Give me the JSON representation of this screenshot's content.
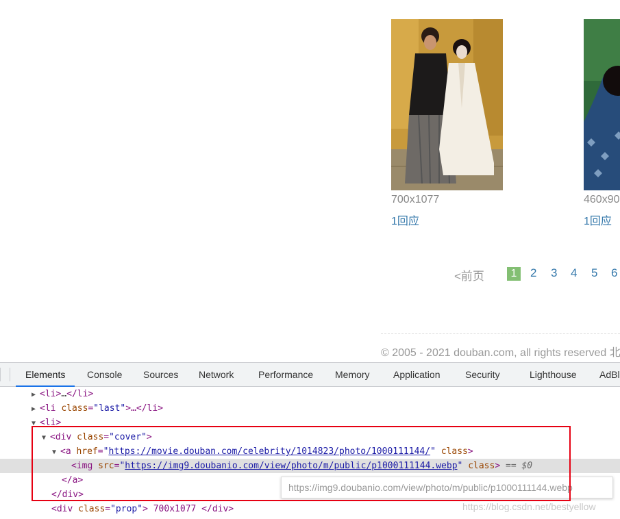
{
  "photos": [
    {
      "size": "700x1077",
      "reply": "1回应"
    },
    {
      "size": "460x90",
      "reply": "1回应"
    }
  ],
  "pager": {
    "prev": "<前页",
    "pages": [
      "1",
      "2",
      "3",
      "4",
      "5",
      "6"
    ],
    "active": "1"
  },
  "footer": {
    "copyright": "© 2005 - 2021 douban.com, all rights reserved 北"
  },
  "devtools": {
    "tabs": [
      "Elements",
      "Console",
      "Sources",
      "Network",
      "Performance",
      "Memory",
      "Application",
      "Security",
      "Lighthouse",
      "AdBl"
    ],
    "active_tab": "Elements",
    "dom": {
      "li1_tag": "<li>",
      "li1_ellipsis": "…",
      "li1_close": "</li>",
      "li2_open": "<li",
      "li2_attr": "class",
      "li2_val": "\"last\"",
      "li2_close": ">…</li>",
      "li3": "<li>",
      "div_open": "<div",
      "div_attr": "class",
      "div_val": "\"cover\"",
      "div_close_bracket": ">",
      "a_open": "<a",
      "a_attr": "href",
      "a_quote_open": "\"",
      "a_href": "https://movie.douban.com/celebrity/1014823/photo/1000111144/",
      "a_quote_close": "\"",
      "a_attr2": "class",
      "a_close_bracket": ">",
      "img_open": "<img",
      "img_attr": "src",
      "img_quote_open": "\"",
      "img_src": "https://img9.doubanio.com/view/photo/m/public/p1000111144.webp",
      "img_quote_close": "\"",
      "img_attr2": "class",
      "img_close_bracket": ">",
      "selected_marker": "== $0",
      "a_end": "</a>",
      "div_end": "</div>",
      "prop_open": "<div",
      "prop_attr": "class",
      "prop_val": "\"prop\"",
      "prop_text": "> 700x1077 </div>"
    },
    "tooltip": "https://img9.doubanio.com/view/photo/m/public/p1000111144.webp"
  },
  "watermark": "https://blog.csdn.net/bestyellow"
}
